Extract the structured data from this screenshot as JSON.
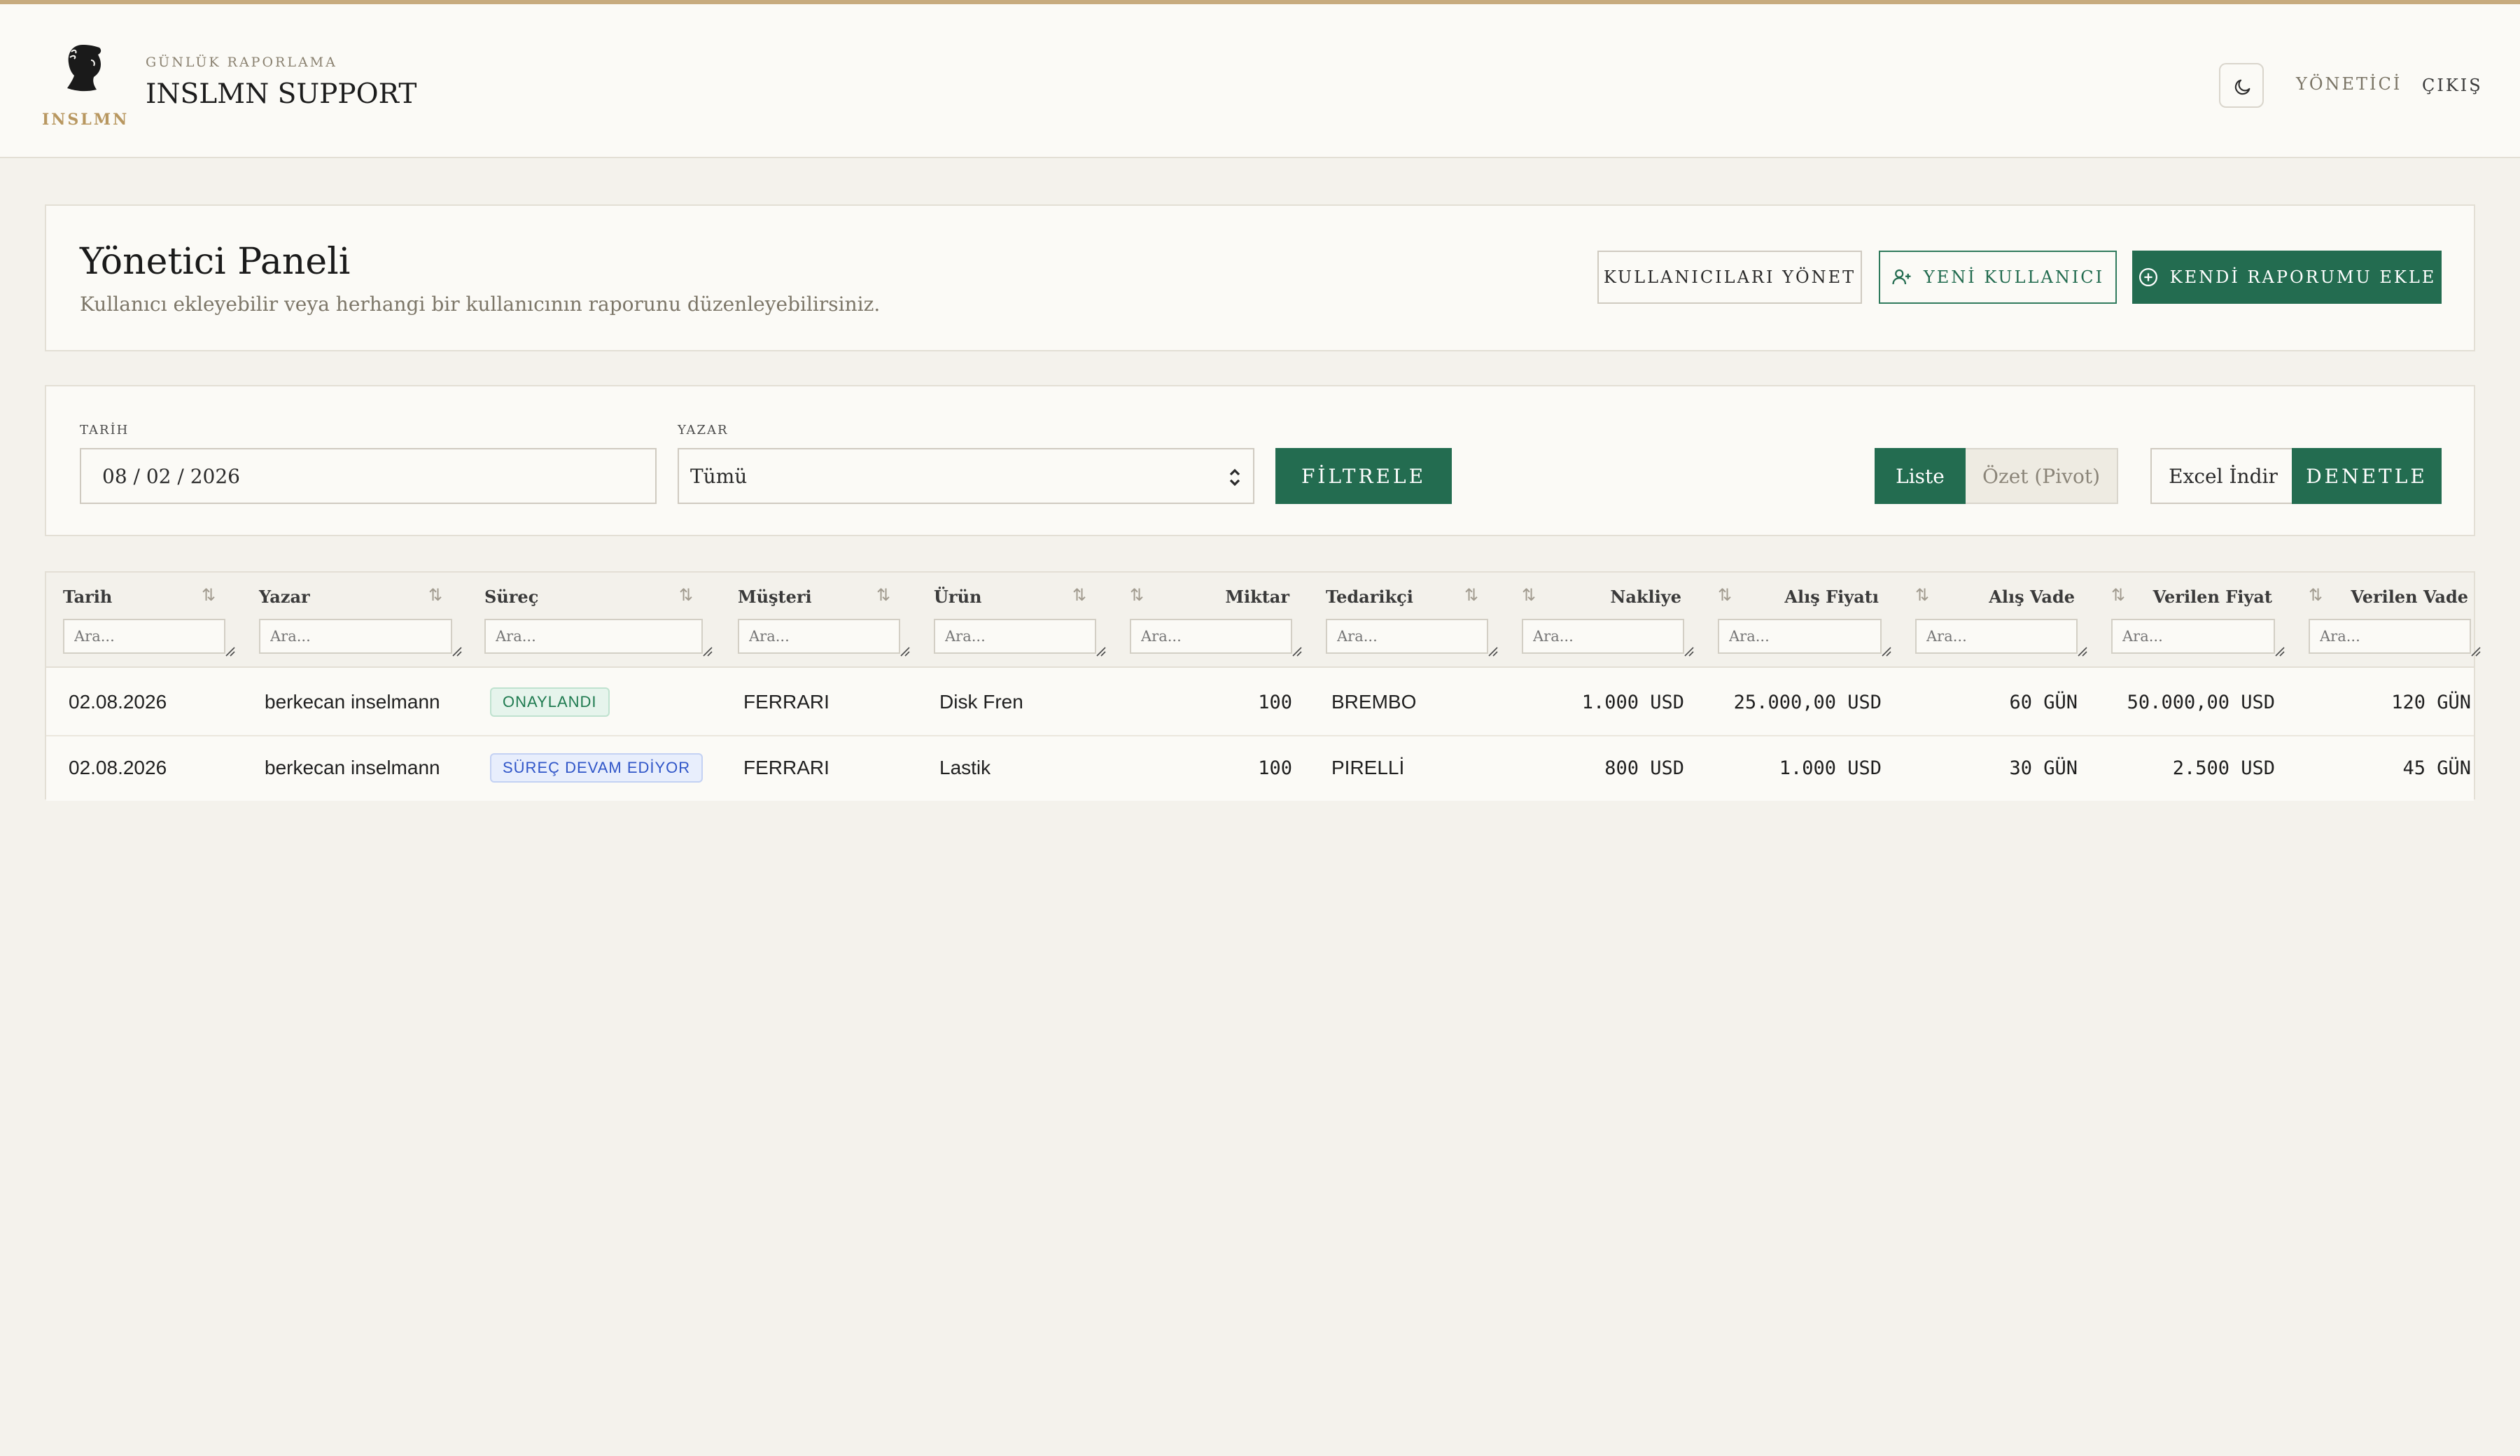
{
  "header": {
    "logo_text": "INSLMN",
    "subtitle": "GÜNLÜK RAPORLAMA",
    "title": "INSLMN SUPPORT",
    "theme_icon": "moon-icon",
    "nav_admin": "YÖNETİCİ",
    "nav_exit": "ÇIKIŞ"
  },
  "panel": {
    "title": "Yönetici Paneli",
    "subtitle": "Kullanıcı ekleyebilir veya herhangi bir kullanıcının raporunu düzenleyebilirsiniz.",
    "manage_users_label": "KULLANICILARI YÖNET",
    "new_user_label": "YENİ KULLANICI",
    "add_my_report_label": "KENDİ RAPORUMU EKLE"
  },
  "filters": {
    "date_label": "TARİH",
    "date_value": "08 / 02 / 2026",
    "author_label": "YAZAR",
    "author_value": "Tümü",
    "filter_button": "FİLTRELE",
    "view_list": "Liste",
    "view_pivot": "Özet (Pivot)",
    "excel_button": "Excel İndir",
    "audit_button": "DENETLE"
  },
  "colors": {
    "accent": "#236c50",
    "top_line": "#c7ab7e",
    "background": "#f4f2ec"
  },
  "table": {
    "search_placeholder": "Ara...",
    "columns": [
      "Tarih",
      "Yazar",
      "Süreç",
      "Müşteri",
      "Ürün",
      "Miktar",
      "Tedarikçi",
      "Nakliye",
      "Alış Fiyatı",
      "Alış Vade",
      "Verilen Fiyat",
      "Verilen Vade"
    ],
    "rows": [
      {
        "tarih": "02.08.2026",
        "yazar": "berkecan inselmann",
        "surec": "ONAYLANDI",
        "musteri": "FERRARI",
        "urun": "Disk Fren",
        "miktar": "100",
        "tedarikci": "BREMBO",
        "nakliye": "1.000 USD",
        "alis_fiyati": "25.000,00 USD",
        "alis_vade": "60 GÜN",
        "verilen_fiyat": "50.000,00 USD",
        "verilen_vade": "120 GÜN"
      },
      {
        "tarih": "02.08.2026",
        "yazar": "berkecan inselmann",
        "surec": "SÜREÇ DEVAM EDİYOR",
        "musteri": "FERRARI",
        "urun": "Lastik",
        "miktar": "100",
        "tedarikci": "PIRELLİ",
        "nakliye": "800 USD",
        "alis_fiyati": "1.000 USD",
        "alis_vade": "30 GÜN",
        "verilen_fiyat": "2.500 USD",
        "verilen_vade": "45 GÜN"
      }
    ]
  }
}
